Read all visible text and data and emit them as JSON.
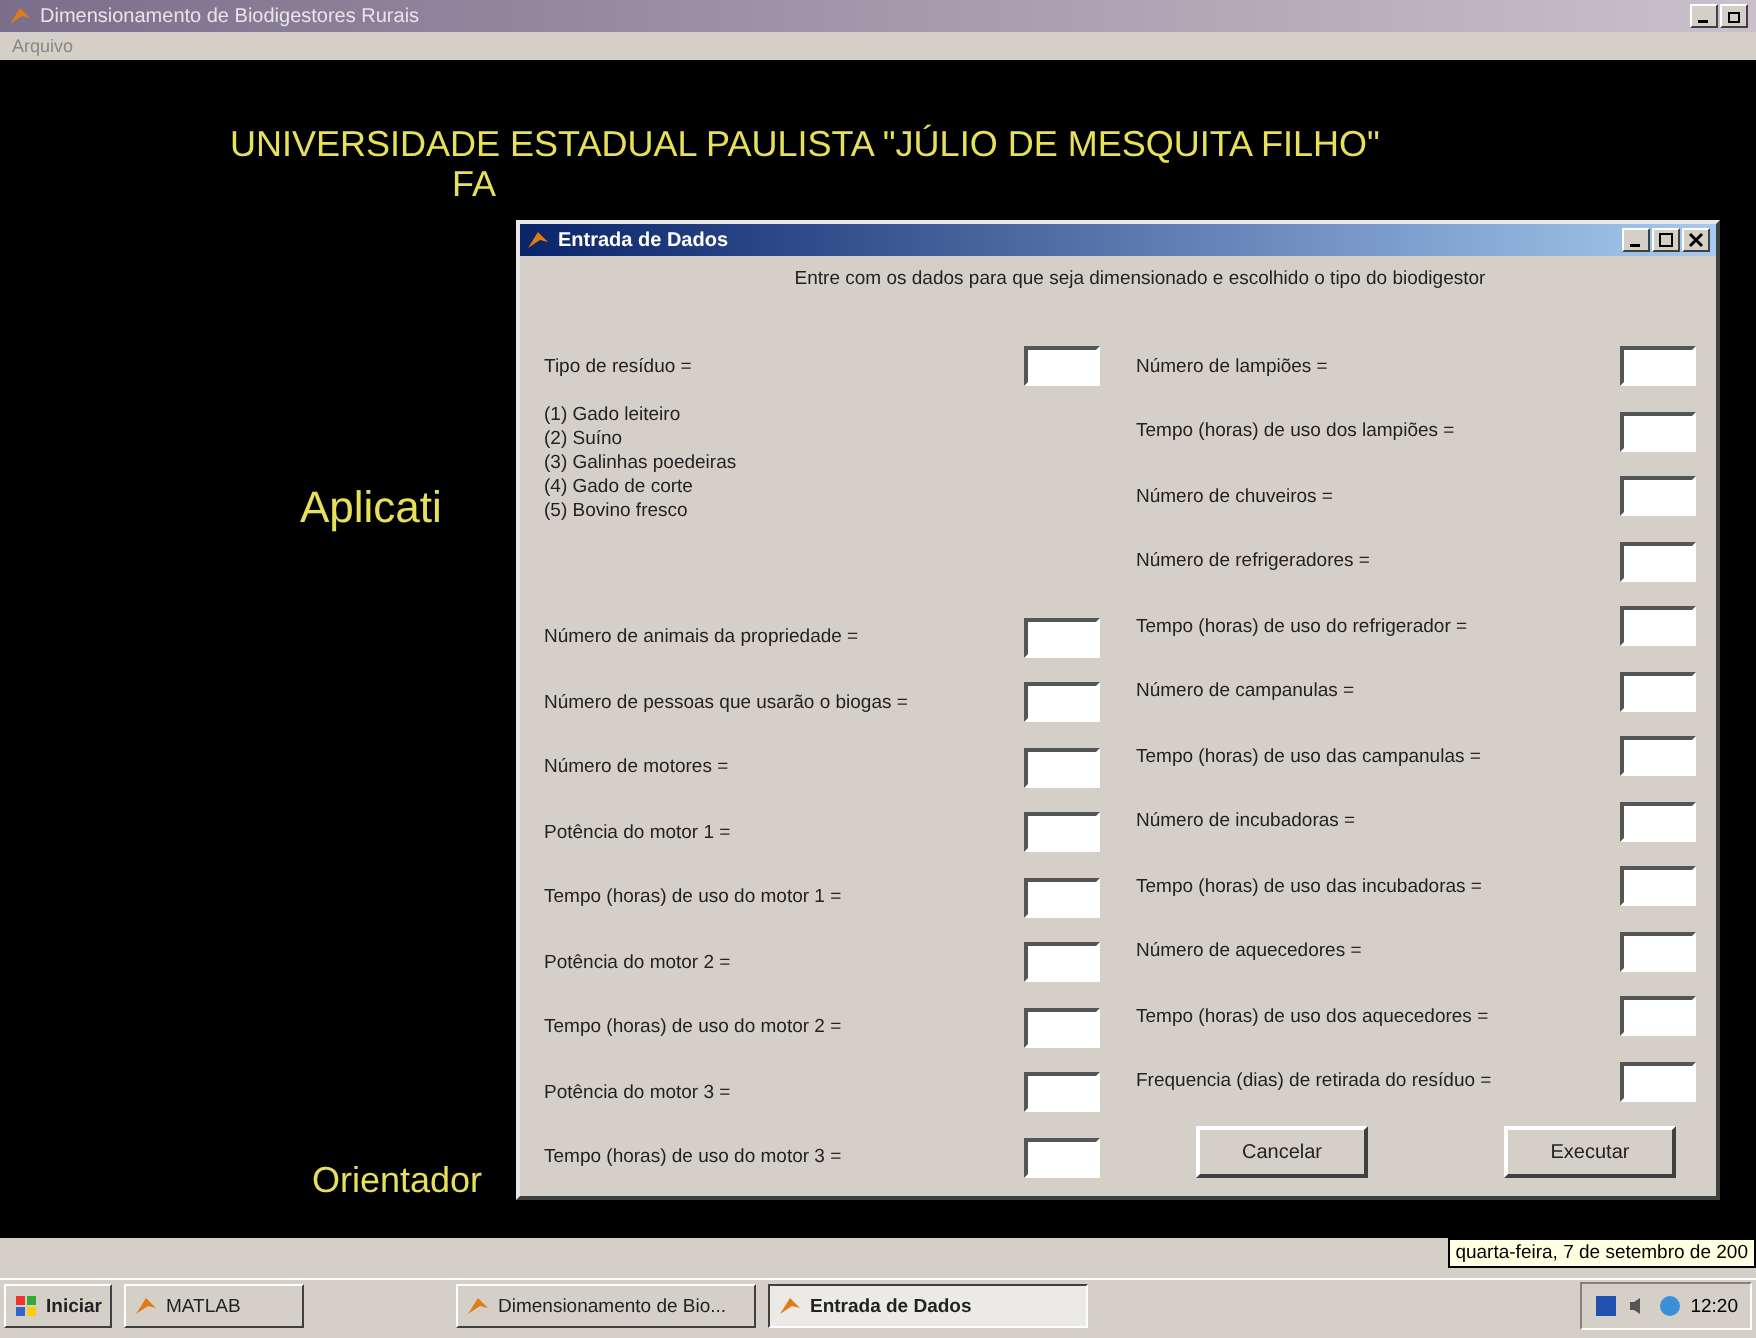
{
  "window": {
    "title": "Dimensionamento de Biodigestores Rurais",
    "menu": [
      "Arquivo"
    ]
  },
  "background_texts": [
    {
      "kind": "heading",
      "text": "UNIVERSIDADE ESTADUAL PAULISTA \"JÚLIO DE MESQUITA FILHO\""
    },
    {
      "kind": "subheading",
      "text": "FA"
    },
    {
      "kind": "title",
      "text": "Aplicati"
    },
    {
      "kind": "credit",
      "text": "Orientador"
    }
  ],
  "dialog": {
    "title": "Entrada de Dados",
    "instruction": "Entre com os dados para que seja dimensionado e escolhido o tipo do biodigestor",
    "left_column": [
      {
        "kind": "field",
        "label": "Tipo de resíduo ="
      },
      {
        "kind": "note",
        "lines": [
          "(1) Gado leiteiro",
          "(2) Suíno",
          "(3) Galinhas poedeiras",
          "(4) Gado de corte",
          "(5) Bovino fresco"
        ]
      },
      {
        "kind": "field",
        "label": "Número de animais da propriedade ="
      },
      {
        "kind": "field",
        "label": "Número de pessoas que usarão o biogas ="
      },
      {
        "kind": "field",
        "label": "Número de motores ="
      },
      {
        "kind": "field",
        "label": "Potência do motor 1 ="
      },
      {
        "kind": "field",
        "label": "Tempo (horas) de uso do motor 1 ="
      },
      {
        "kind": "field",
        "label": "Potência do motor 2 ="
      },
      {
        "kind": "field",
        "label": "Tempo (horas) de uso do motor 2 ="
      },
      {
        "kind": "field",
        "label": "Potência do motor 3 ="
      },
      {
        "kind": "field",
        "label": "Tempo (horas) de uso do motor 3 ="
      }
    ],
    "right_column": [
      {
        "kind": "field",
        "label": "Número de lampiões ="
      },
      {
        "kind": "field",
        "label": "Tempo (horas) de uso dos lampiões ="
      },
      {
        "kind": "field",
        "label": "Número de chuveiros ="
      },
      {
        "kind": "field",
        "label": "Número de refrigeradores ="
      },
      {
        "kind": "field",
        "label": "Tempo (horas) de uso do refrigerador ="
      },
      {
        "kind": "field",
        "label": "Número de campanulas ="
      },
      {
        "kind": "field",
        "label": "Tempo (horas) de uso das campanulas ="
      },
      {
        "kind": "field",
        "label": "Número de incubadoras ="
      },
      {
        "kind": "field",
        "label": "Tempo (horas) de uso das incubadoras ="
      },
      {
        "kind": "field",
        "label": "Número de aquecedores ="
      },
      {
        "kind": "field",
        "label": "Tempo (horas) de uso dos aquecedores ="
      },
      {
        "kind": "field",
        "label": "Frequencia (dias) de retirada do resíduo ="
      }
    ],
    "buttons": [
      "Cancelar",
      "Executar"
    ]
  },
  "taskbar": {
    "start": "Iniciar",
    "items": [
      {
        "label": "MATLAB",
        "selected": false
      },
      {
        "label": "Dimensionamento de Bio...",
        "selected": false
      },
      {
        "label": "Entrada de Dados",
        "selected": true
      }
    ],
    "tooltip": "quarta-feira, 7 de setembro de 200",
    "clock": "12:20"
  }
}
